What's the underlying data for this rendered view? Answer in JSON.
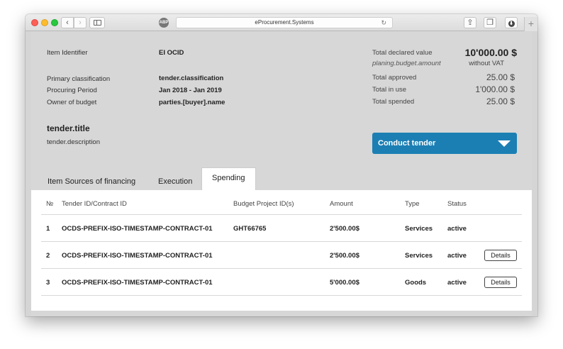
{
  "browser": {
    "url": "eProcurement.Systems",
    "favicon_text": "ABP",
    "back_glyph": "‹",
    "forward_glyph": "›",
    "reload_glyph": "↻",
    "share_glyph": "⇪",
    "tabs_glyph": "❐",
    "download_glyph": "⬇",
    "newtab_glyph": "+"
  },
  "info": {
    "item_identifier_label": "Item Identifier",
    "item_identifier_value": "EI OCID",
    "primary_classification_label": "Primary classification",
    "primary_classification_value": "tender.classification",
    "procuring_period_label": "Procuring Period",
    "procuring_period_value": "Jan 2018 - Jan 2019",
    "owner_label": "Owner of budget",
    "owner_value": "parties.[buyer].name"
  },
  "totals": {
    "declared_label": "Total declared value",
    "declared_sub": "planing.budget.amount",
    "declared_value": "10'000.00 $",
    "declared_vat": "without VAT",
    "approved_label": "Total approved",
    "approved_value": "25.00 $",
    "in_use_label": "Total in use",
    "in_use_value": "1'000.00 $",
    "spended_label": "Total spended",
    "spended_value": "25.00 $"
  },
  "tender": {
    "title": "tender.title",
    "description": "tender.description",
    "conduct_label": "Conduct tender"
  },
  "tabs": [
    {
      "label": "Item Sources of financing"
    },
    {
      "label": "Execution"
    },
    {
      "label": "Spending"
    }
  ],
  "table": {
    "headers": [
      "№",
      "Tender ID/Contract ID",
      "Budget Project ID(s)",
      "Amount",
      "Type",
      "Status"
    ],
    "rows": [
      {
        "num": "1",
        "contract": "OCDS-PREFIX-ISO-TIMESTAMP-CONTRACT-01",
        "budget": "GHT66765",
        "amount": "2'500.00$",
        "type": "Services",
        "status": "active",
        "action": ""
      },
      {
        "num": "2",
        "contract": "OCDS-PREFIX-ISO-TIMESTAMP-CONTRACT-01",
        "budget": "",
        "amount": "2'500.00$",
        "type": "Services",
        "status": "active",
        "action": "Details"
      },
      {
        "num": "3",
        "contract": "OCDS-PREFIX-ISO-TIMESTAMP-CONTRACT-01",
        "budget": "",
        "amount": "5'000.00$",
        "type": "Goods",
        "status": "active",
        "action": "Details"
      }
    ]
  }
}
